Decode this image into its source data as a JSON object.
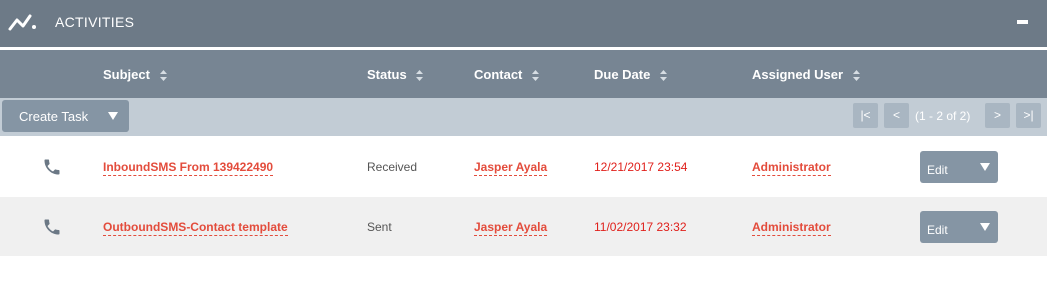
{
  "header": {
    "title": "ACTIVITIES",
    "logo_icon": "activity-graph-icon",
    "collapse_icon": "minus-icon"
  },
  "columns": [
    {
      "label": "Subject"
    },
    {
      "label": "Status"
    },
    {
      "label": "Contact"
    },
    {
      "label": "Due Date"
    },
    {
      "label": "Assigned User"
    }
  ],
  "toolbar": {
    "create_label": "Create Task",
    "pager": {
      "first": "|<",
      "prev": "<",
      "count": "(1 - 2 of 2)",
      "next": ">",
      "last": ">|"
    }
  },
  "rows": [
    {
      "icon": "phone-icon",
      "subject": "InboundSMS From 139422490",
      "status": "Received",
      "contact": "Jasper Ayala",
      "due_date": "12/21/2017 23:54",
      "assigned_user": "Administrator",
      "edit_label": "Edit"
    },
    {
      "icon": "phone-icon",
      "subject": "OutboundSMS-Contact template",
      "status": "Sent",
      "contact": "Jasper Ayala",
      "due_date": "11/02/2017 23:32",
      "assigned_user": "Administrator",
      "edit_label": "Edit"
    }
  ],
  "colors": {
    "header_bg": "#6d7a87",
    "column_header_bg": "#778593",
    "toolbar_bg": "#c2ccd5",
    "button_bg": "#8595a4",
    "link": "#e34c3c",
    "overdue_date": "#e0201b"
  }
}
